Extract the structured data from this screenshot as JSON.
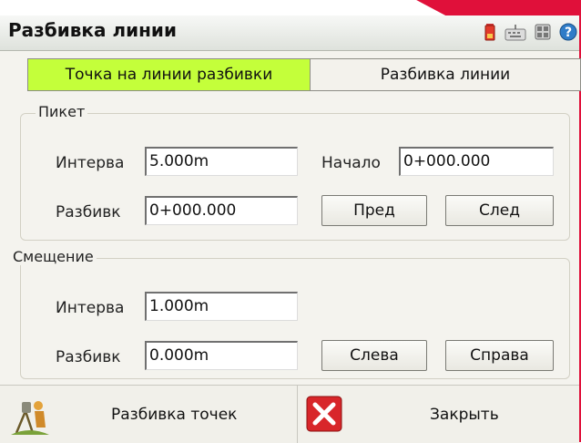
{
  "window": {
    "title": "Разбивка линии"
  },
  "title_icons": [
    "battery-icon",
    "keyboard-icon",
    "grid-icon",
    "help-icon"
  ],
  "tabs": [
    {
      "label": "Точка на линии разбивки",
      "active": true
    },
    {
      "label": "Разбивка линии",
      "active": false
    }
  ],
  "piket": {
    "legend": "Пикет",
    "interval_label": "Интерва",
    "interval_value": "5.000m",
    "start_label": "Начало",
    "start_value": "0+000.000",
    "stakeout_label": "Разбивк",
    "stakeout_value": "0+000.000",
    "prev_label": "Пред",
    "next_label": "След"
  },
  "offset": {
    "legend": "Смещение",
    "interval_label": "Интерва",
    "interval_value": "1.000m",
    "stakeout_label": "Разбивк",
    "stakeout_value": "0.000m",
    "left_label": "Слева",
    "right_label": "Справа"
  },
  "bottom": {
    "stake_points_label": "Разбивка точек",
    "close_label": "Закрыть"
  },
  "colors": {
    "active_tab": "#c4ff3a",
    "background_accent": "#e0103a",
    "close_icon": "#d8262a"
  }
}
